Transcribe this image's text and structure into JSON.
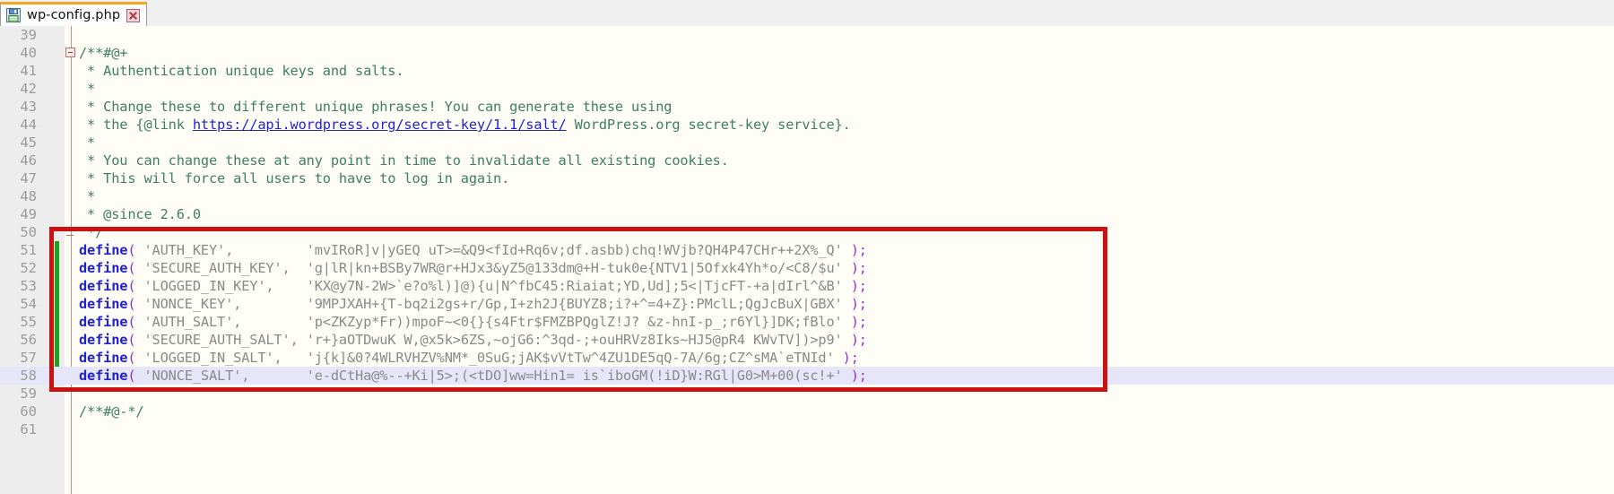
{
  "window": {
    "tab": {
      "title": "wp-config.php",
      "save_icon": "floppy-save-icon",
      "close_icon": "close-x-icon"
    }
  },
  "colors": {
    "tab_accent": "#f5a623",
    "comment": "#3f7f5f",
    "keyword": "#2222cc",
    "string": "#8a8a8a",
    "paren": "#9b30d0",
    "annotation_box": "#cc1111",
    "change_marker": "#1fa31f",
    "current_line": "#e6e6fa",
    "editor_background": "#fffef6",
    "gutter_background": "#ededed"
  },
  "editor": {
    "first_visible_line": 39,
    "current_line": 58,
    "link_text": "https://api.wordpress.org/secret-key/1.1/salt/",
    "lines": [
      {
        "n": "39",
        "text": ""
      },
      {
        "n": "40",
        "text": "/**#@+"
      },
      {
        "n": "41",
        "text": " * Authentication unique keys and salts."
      },
      {
        "n": "42",
        "text": " *"
      },
      {
        "n": "43",
        "text": " * Change these to different unique phrases! You can generate these using"
      },
      {
        "n": "44",
        "text": " * the {@link https://api.wordpress.org/secret-key/1.1/salt/ WordPress.org secret-key service}."
      },
      {
        "n": "45",
        "text": " *"
      },
      {
        "n": "46",
        "text": " * You can change these at any point in time to invalidate all existing cookies."
      },
      {
        "n": "47",
        "text": " * This will force all users to have to log in again."
      },
      {
        "n": "48",
        "text": " *"
      },
      {
        "n": "49",
        "text": " * @since 2.6.0"
      },
      {
        "n": "50",
        "text": " */"
      },
      {
        "n": "51",
        "text": "define( 'AUTH_KEY',         'mvIRoR]v|yGEQ uT>=&Q9<fId+Rq6v;df.asbb)chq!WVjb?QH4P47CHr++2X%_Q' );"
      },
      {
        "n": "52",
        "text": "define( 'SECURE_AUTH_KEY',  'g|lR|kn+BSBy7WR@r+HJx3&yZ5@133dm@+H-tuk0e{NTV1|5Ofxk4Yh*o/<C8/$u' );"
      },
      {
        "n": "53",
        "text": "define( 'LOGGED_IN_KEY',    'KX@y7N-2W>`e?o%l)]@){u|N^fbC45:Riaiat;YD,Ud];5<|TjcFT-+a|dIrl^&B' );"
      },
      {
        "n": "54",
        "text": "define( 'NONCE_KEY',        '9MPJXAH+{T-bq2i2gs+r/Gp,I+zh2J{BUYZ8;i?+^=4+Z}:PMclL;QgJcBuX|GBX' );"
      },
      {
        "n": "55",
        "text": "define( 'AUTH_SALT',        'p<ZKZyp*Fr))mpoF~<0{}{s4Ftr$FMZBPQglZ!J? &z-hnI-p_;r6Yl}]DK;fBlo' );"
      },
      {
        "n": "56",
        "text": "define( 'SECURE_AUTH_SALT', 'r+}aOTDwuK W,@x5k>6ZS,~ojG6:^3qd-;+ouHRVz8Iks~HJ5@pR4 KWvTV])>p9' );"
      },
      {
        "n": "57",
        "text": "define( 'LOGGED_IN_SALT',   'j{k]&0?4WLRVHZV%NM*_0SuG;jAK$vVtTw^4ZU1DE5qQ-7A/6g;CZ^sMA`eTNId' );"
      },
      {
        "n": "58",
        "text": "define( 'NONCE_SALT',       'e-dCtHa@%--+Ki|5>;(<tDO]ww=Hin1= is`iboGM(!iD}W:RGl|G0>M+00(sc!+' );"
      },
      {
        "n": "59",
        "text": ""
      },
      {
        "n": "60",
        "text": "/**#@-*/"
      },
      {
        "n": "61",
        "text": ""
      }
    ]
  },
  "annotation": {
    "type": "red-highlight-rectangle",
    "covers_lines": "50-58",
    "color": "#cc1111"
  }
}
